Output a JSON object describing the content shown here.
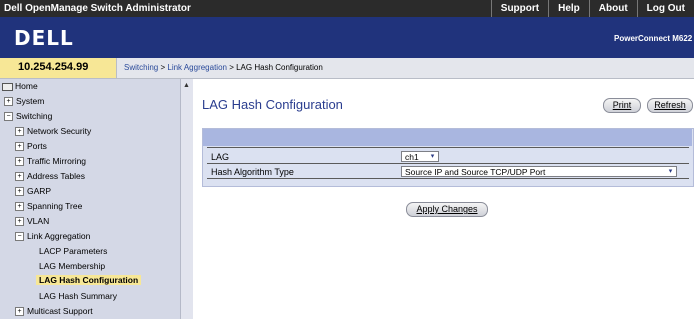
{
  "topbar": {
    "title": "Dell OpenManage Switch Administrator",
    "links": [
      "Support",
      "Help",
      "About",
      "Log Out"
    ]
  },
  "header": {
    "logo": "DELL",
    "product": "PowerConnect M6220"
  },
  "ip": "10.254.254.99",
  "breadcrumb": {
    "part1": "Switching",
    "sep1": " > ",
    "part2": "Link Aggregation",
    "sep2": " > ",
    "part3": "LAG Hash Configuration"
  },
  "sidebar": {
    "items": [
      {
        "label": "Home",
        "icon": "home-icon"
      },
      {
        "label": "System",
        "icon": "plus"
      },
      {
        "label": "Switching",
        "icon": "minus"
      },
      {
        "label": "Network Security",
        "icon": "plus"
      },
      {
        "label": "Ports",
        "icon": "plus"
      },
      {
        "label": "Traffic Mirroring",
        "icon": "plus"
      },
      {
        "label": "Address Tables",
        "icon": "plus"
      },
      {
        "label": "GARP",
        "icon": "plus"
      },
      {
        "label": "Spanning Tree",
        "icon": "plus"
      },
      {
        "label": "VLAN",
        "icon": "plus"
      },
      {
        "label": "Link Aggregation",
        "icon": "minus"
      },
      {
        "label": "LACP Parameters",
        "icon": ""
      },
      {
        "label": "LAG Membership",
        "icon": ""
      },
      {
        "label": "LAG Hash Configuration",
        "icon": ""
      },
      {
        "label": "LAG Hash Summary",
        "icon": ""
      },
      {
        "label": "Multicast Support",
        "icon": "plus"
      }
    ]
  },
  "page": {
    "title": "LAG Hash Configuration",
    "print_label": "Print",
    "refresh_label": "Refresh"
  },
  "form": {
    "lag_label": "LAG",
    "lag_value": "ch1",
    "hash_label": "Hash Algorithm Type",
    "hash_value": "Source IP and Source TCP/UDP Port",
    "apply_label": "Apply Changes"
  }
}
